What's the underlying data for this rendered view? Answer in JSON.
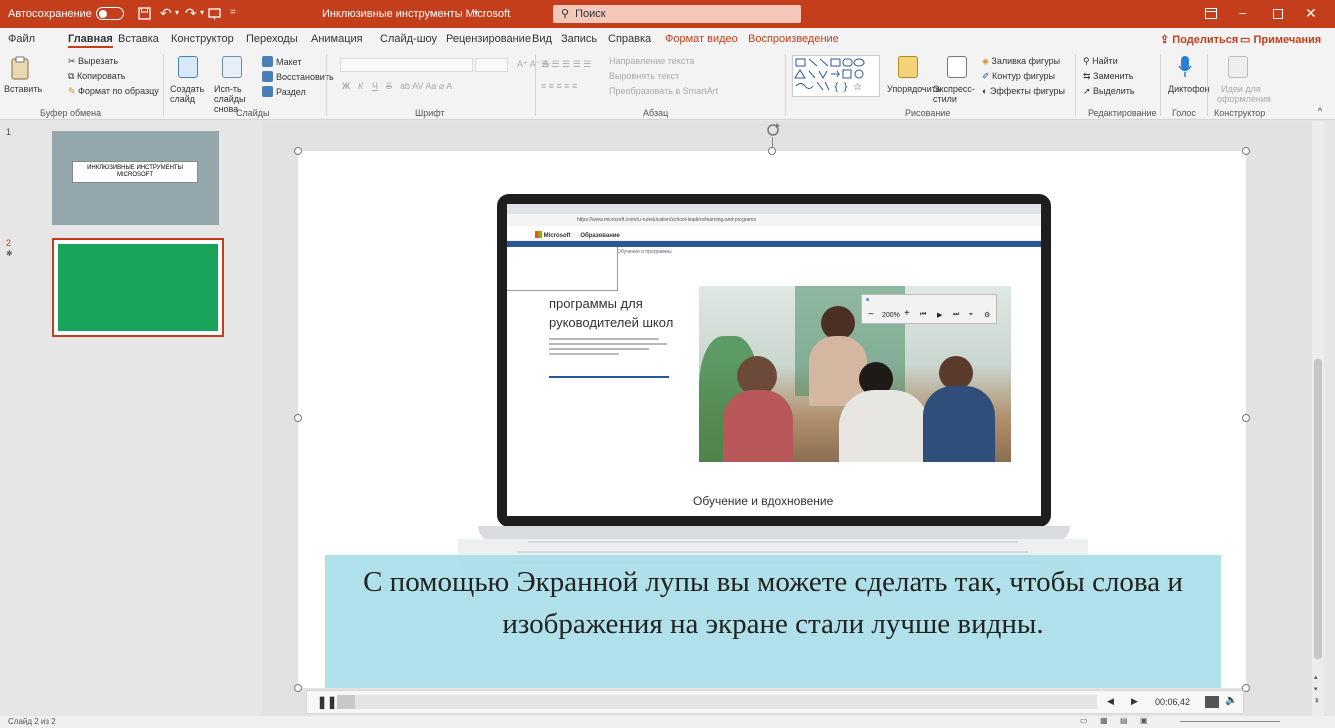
{
  "titlebar": {
    "autosave_label": "Автосохранение",
    "doc_title": "Инклюзивные инструменты Microsoft",
    "search_placeholder": "Поиск"
  },
  "menu": {
    "tabs": [
      "Файл",
      "Главная",
      "Вставка",
      "Конструктор",
      "Переходы",
      "Анимация",
      "Слайд-шоу",
      "Рецензирование",
      "Вид",
      "Запись",
      "Справка",
      "Формат видео",
      "Воспроизведение"
    ],
    "active_tab": "Главная",
    "share_label": "Поделиться",
    "comments_label": "Примечания"
  },
  "ribbon": {
    "clipboard": {
      "paste": "Вставить",
      "cut": "Вырезать",
      "copy": "Копировать",
      "format_painter": "Формат по образцу",
      "group": "Буфер обмена"
    },
    "slides": {
      "new_slide": "Создать слайд",
      "reuse": "Исп-ть слайды снова",
      "layout": "Макет",
      "reset": "Восстановить",
      "section": "Раздел",
      "group": "Слайды"
    },
    "font": {
      "group": "Шрифт",
      "bold": "Ж",
      "italic": "К",
      "underline": "Ч",
      "strike": "S"
    },
    "paragraph": {
      "direction": "Направление текста",
      "align": "Выровнять текст",
      "smartart": "Преобразовать в SmartArt",
      "group": "Абзац"
    },
    "drawing": {
      "arrange": "Упорядочить",
      "quick_styles": "Экспресс-стили",
      "fill": "Заливка фигуры",
      "outline": "Контур фигуры",
      "effects": "Эффекты фигуры",
      "group": "Рисование"
    },
    "editing": {
      "find": "Найти",
      "replace": "Заменить",
      "select": "Выделить",
      "group": "Редактирование"
    },
    "voice": {
      "dictate": "Диктофон",
      "group": "Голос"
    },
    "designer": {
      "ideas": "Идеи для оформления",
      "group": "Конструктор"
    }
  },
  "thumbnails": [
    {
      "number": "1",
      "title": "ИНКЛЮЗИВНЫЕ ИНСТРУМЕНТЫ MICROSOFT"
    },
    {
      "number": "2",
      "title": ""
    }
  ],
  "slide": {
    "caption": "С помощью Экранной лупы вы можете сделать так, чтобы слова и изображения на экране стали лучше видны.",
    "laptop_screen": {
      "browser_url": "https://www.microsoft.com/ru-ru/education/school-leaders/learning-and-programs",
      "brand": "Microsoft",
      "nav_section": "Образование",
      "breadcrumb": "Обучение и программы",
      "heading_partial": "программы для",
      "heading_line2": "руководителей школ",
      "bottom_heading": "Обучение и вдохновение",
      "magnifier_zoom": "200%"
    }
  },
  "video": {
    "time": "00:06,42"
  },
  "status": {
    "slide_counter": "Слайд 2 из 2"
  },
  "colors": {
    "accent": "#c43e1c",
    "slide2_thumb": "#1aa35a",
    "caption_bg": "#a9dde8"
  }
}
